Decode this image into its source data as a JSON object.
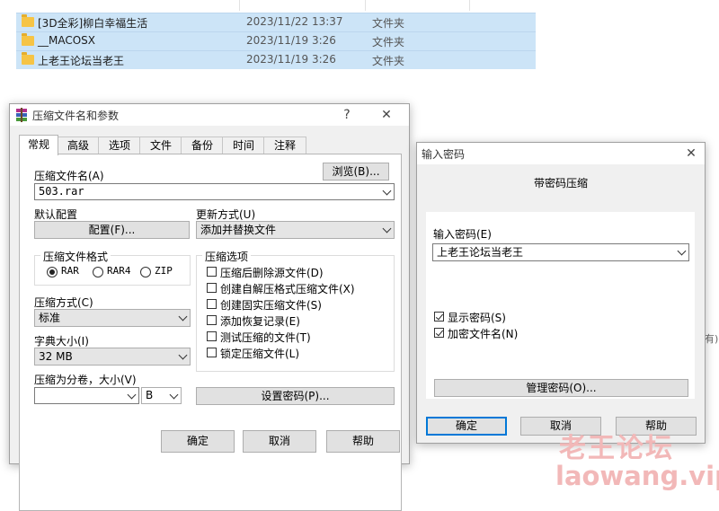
{
  "explorer": {
    "rows": [
      {
        "name": "[3D全彩]柳白幸福生活",
        "date": "2023/11/22 13:37",
        "type": "文件夹"
      },
      {
        "name": "__MACOSX",
        "date": "2023/11/19 3:26",
        "type": "文件夹"
      },
      {
        "name": "上老王论坛当老王",
        "date": "2023/11/19 3:26",
        "type": "文件夹"
      }
    ],
    "side_text": "有)"
  },
  "archive_dialog": {
    "title": "压缩文件名和参数",
    "help_glyph": "?",
    "close_glyph": "✕",
    "tabs": [
      "常规",
      "高级",
      "选项",
      "文件",
      "备份",
      "时间",
      "注释"
    ],
    "archive_name_label": "压缩文件名(A)",
    "browse_label": "浏览(B)...",
    "archive_name_value": "503.rar",
    "profile_label": "默认配置",
    "profile_button": "配置(F)...",
    "update_mode_label": "更新方式(U)",
    "update_mode_value": "添加并替换文件",
    "format_group": "压缩文件格式",
    "formats": [
      {
        "label": "RAR",
        "checked": true
      },
      {
        "label": "RAR4",
        "checked": false
      },
      {
        "label": "ZIP",
        "checked": false
      }
    ],
    "options_group": "压缩选项",
    "options": [
      {
        "label": "压缩后删除源文件(D)",
        "checked": false
      },
      {
        "label": "创建自解压格式压缩文件(X)",
        "checked": false
      },
      {
        "label": "创建固实压缩文件(S)",
        "checked": false
      },
      {
        "label": "添加恢复记录(E)",
        "checked": false
      },
      {
        "label": "测试压缩的文件(T)",
        "checked": false
      },
      {
        "label": "锁定压缩文件(L)",
        "checked": false
      }
    ],
    "method_label": "压缩方式(C)",
    "method_value": "标准",
    "dict_label": "字典大小(I)",
    "dict_value": "32 MB",
    "split_label": "压缩为分卷，大小(V)",
    "split_value": "",
    "split_unit": "B",
    "set_password_button": "设置密码(P)...",
    "ok_button": "确定",
    "cancel_button": "取消",
    "help_button": "帮助"
  },
  "password_dialog": {
    "title": "输入密码",
    "close_glyph": "✕",
    "heading": "带密码压缩",
    "password_label": "输入密码(E)",
    "password_value": "上老王论坛当老王",
    "show_password_label": "显示密码(S)",
    "show_password_checked": true,
    "encrypt_names_label": "加密文件名(N)",
    "encrypt_names_checked": true,
    "manage_button": "管理密码(O)...",
    "ok_button": "确定",
    "cancel_button": "取消",
    "help_button": "帮助"
  },
  "watermark": {
    "title": "老王论坛",
    "url": "laowang.vip"
  }
}
